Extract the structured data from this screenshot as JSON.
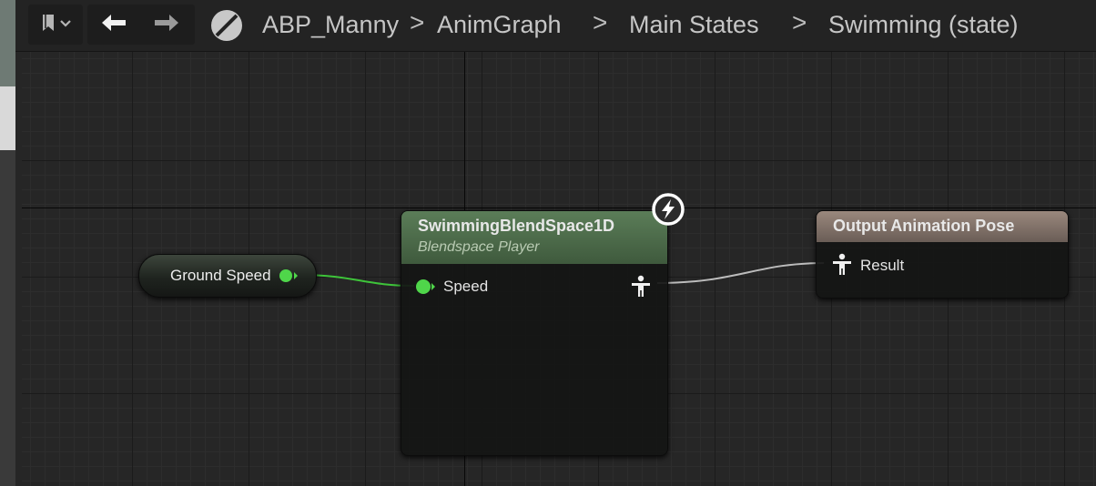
{
  "breadcrumb": {
    "items": [
      "ABP_Manny",
      "AnimGraph",
      "Main States",
      "Swimming (state)"
    ],
    "separator": ">"
  },
  "toolbar": {
    "bookmark_icon": "bookmark-icon",
    "back_icon": "arrow-left-icon",
    "forward_icon": "arrow-right-icon",
    "blueprint_icon": "no-blueprint-icon"
  },
  "nodes": {
    "variable": {
      "label": "Ground Speed",
      "pin_color": "#4fd64a"
    },
    "blendspace": {
      "title": "SwimmingBlendSpace1D",
      "subtitle": "Blendspace Player",
      "input_pin": "Speed",
      "header_color": "#4f6e4c",
      "badge_icon": "lightning-bolt-icon"
    },
    "output": {
      "title": "Output Animation Pose",
      "input_pin": "Result",
      "header_color": "#7d6e66"
    }
  },
  "colors": {
    "float_wire": "#3ec43a",
    "pose_wire": "#b8b8b8",
    "graph_background": "#262626"
  }
}
